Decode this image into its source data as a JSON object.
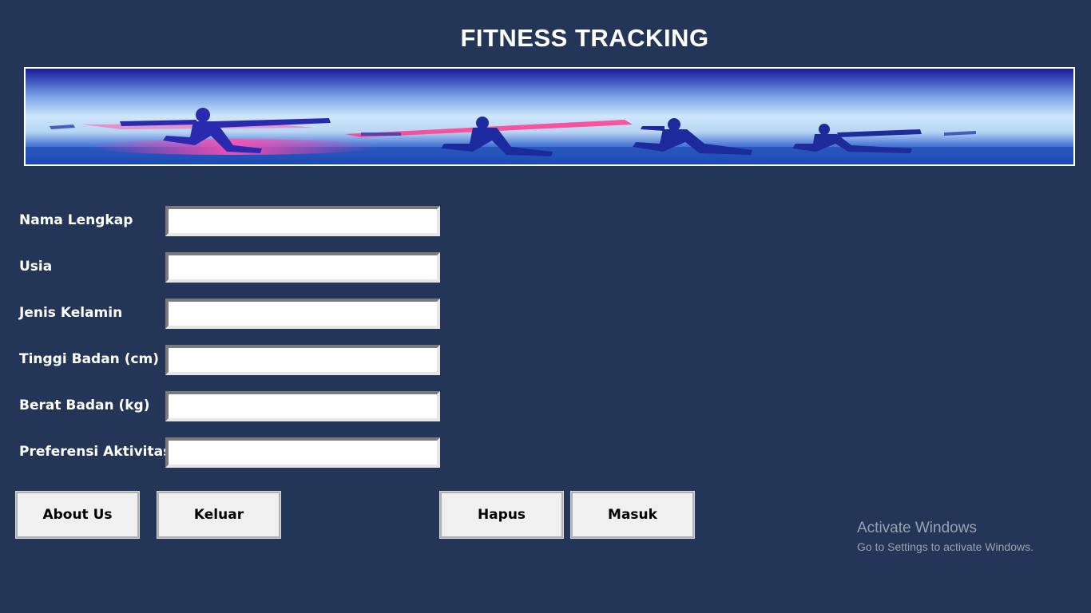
{
  "title": "FITNESS TRACKING",
  "form": {
    "fields": [
      {
        "label": "Nama Lengkap",
        "value": ""
      },
      {
        "label": "Usia",
        "value": ""
      },
      {
        "label": "Jenis Kelamin",
        "value": ""
      },
      {
        "label": "Tinggi Badan (cm)",
        "value": ""
      },
      {
        "label": "Berat Badan (kg)",
        "value": ""
      },
      {
        "label": "Preferensi Aktivitas",
        "value": ""
      }
    ]
  },
  "buttons": {
    "about": "About Us",
    "keluar": "Keluar",
    "hapus": "Hapus",
    "masuk": "Masuk"
  },
  "watermark": {
    "line1": "Activate Windows",
    "line2": "Go to Settings to activate Windows."
  },
  "colors": {
    "background": "#233657",
    "button": "#f0f0f0",
    "text": "#ffffff"
  }
}
